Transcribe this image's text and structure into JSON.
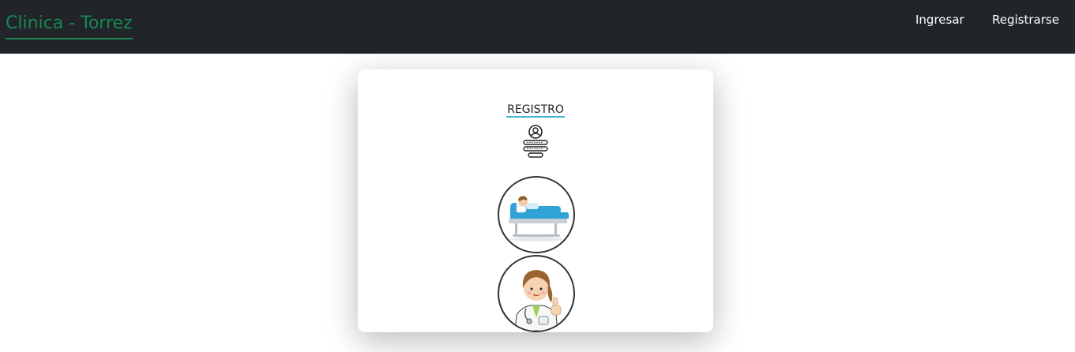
{
  "navbar": {
    "brand": "Clinica - Torrez",
    "links": [
      "Ingresar",
      "Registrarse"
    ]
  },
  "card": {
    "title": "REGISTRO",
    "icon": "user-form-icon",
    "options": [
      {
        "icon": "patient-in-bed-icon"
      },
      {
        "icon": "doctor-icon"
      }
    ]
  },
  "colors": {
    "navbar_bg": "#212529",
    "brand": "#198754",
    "title_underline": "#45b2d8"
  }
}
